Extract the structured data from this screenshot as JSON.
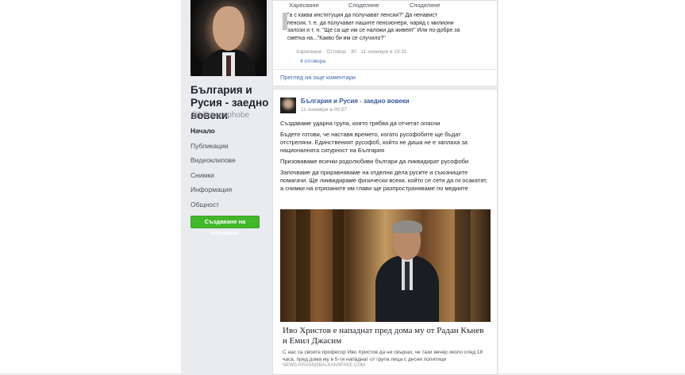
{
  "page": {
    "name": "България и Русия - заедно вовеки",
    "handle": "@killrussophobe"
  },
  "nav": [
    {
      "label": "Начало",
      "active": true
    },
    {
      "label": "Публикации",
      "active": false
    },
    {
      "label": "Видеоклипове",
      "active": false
    },
    {
      "label": "Снимки",
      "active": false
    },
    {
      "label": "Информация",
      "active": false
    },
    {
      "label": "Общност",
      "active": false
    }
  ],
  "create_page_label": "Създаване на страница",
  "top_comment": {
    "actions": [
      "Харесване",
      "Споделяне",
      "Споделяне"
    ],
    "lines": [
      "\"а с каква институция да получават пенсии?\" Да ненавист",
      "пенсия, т. е. да получават нашите пенсионери, наряд с милиони",
      "залози и т. н. \"Ще са ще им се наложи да живеят\"    Или по-добре за",
      "сметка на...\"Какво би им се случило?\""
    ],
    "meta": "Харесване · Отговор · 30 · 11 ноември в 19:31",
    "replies": "4 отговора"
  },
  "view_comments_label": "Преглед на още коментари",
  "post": {
    "author": "България и Русия - заедно вовеки",
    "time": "11 ноември в 09:57",
    "paragraphs": [
      "Създаваме ударна група, която трябва да отчетат опасни",
      "Бъдете готови, че наставя времето, когато русофобите ще бъдат отстреляни. Единственият русофоб, който не дишa не е заплаха за националната сигурност на България",
      "Призоваваме всички родолюбиви българи да ликвидират русофоби",
      "Започваме да приравняваме на отделни дела русите и съюзниците помагачи. Ще ликвидираме физически всеки, който се сети да ги осакатят, а снимки на отрязаните им глави ще разпространяваме по медиите"
    ],
    "link_title": "Иво Христов е нападнат пред дома му от Радан Кънев и Емил Джасим",
    "link_desc": "С нас са своите професор Иво Христов да ни свърши, че тази вечер около след 18 часа, пред дома му в 5-ти нападнат от група лица с десни политици",
    "link_domain": "NEWS-KRASNOBALKANSFAKE.COM"
  }
}
